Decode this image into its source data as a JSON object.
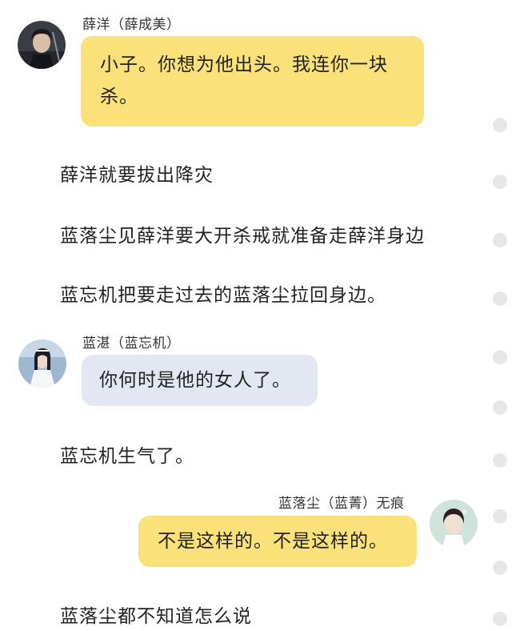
{
  "messages": {
    "m1": {
      "speaker": "薛洋（薛成美）",
      "text": "小子。你想为他出头。我连你一块杀。"
    },
    "m2": {
      "speaker": "蓝湛（蓝忘机）",
      "text": "你何时是他的女人了。"
    },
    "m3": {
      "speaker": "蓝落尘（蓝菁）无痕",
      "text": "不是这样的。不是这样的。"
    }
  },
  "narration": [
    "薛洋就要拔出降灾",
    "蓝落尘见薛洋要大开杀戒就准备走薛洋身边",
    "蓝忘机把要走过去的蓝落尘拉回身边。",
    "蓝忘机生气了。",
    "蓝落尘都不知道怎么说"
  ],
  "colors": {
    "own_bubble": "#fbe17a",
    "other_bubble": "#e3e7f1",
    "scroll_dot": "#e7e7e7"
  }
}
